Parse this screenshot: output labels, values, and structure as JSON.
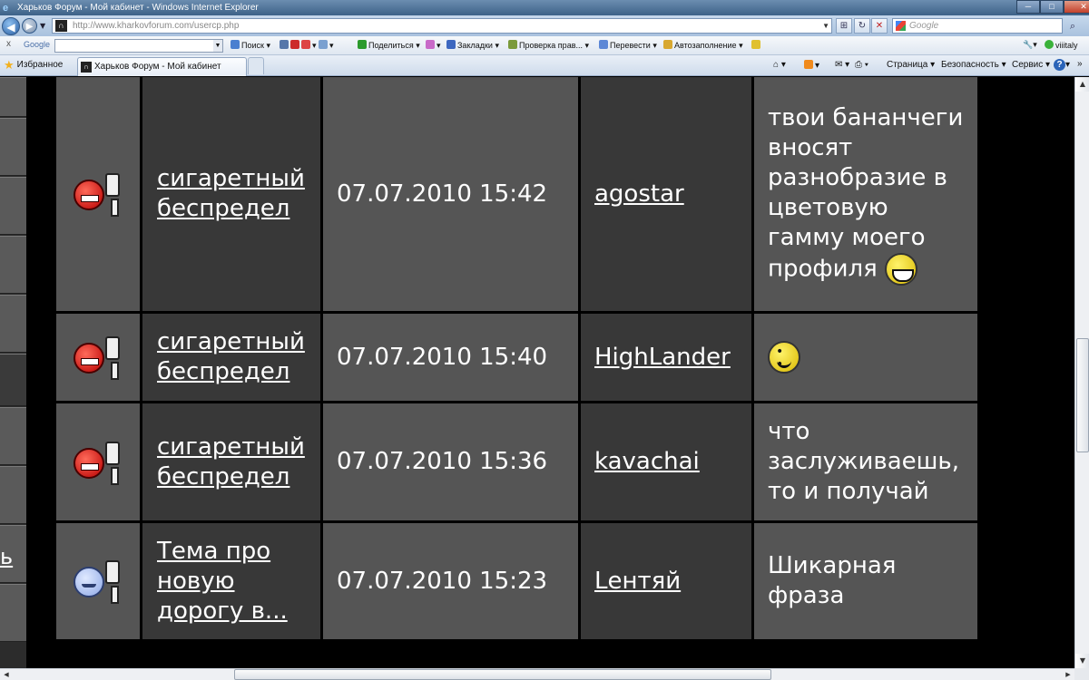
{
  "window": {
    "title": "Харьков Форум - Мой кабинет - Windows Internet Explorer",
    "controls": {
      "minimize": "─",
      "maximize": "□",
      "close": "✕"
    }
  },
  "address": {
    "url": "http://www.kharkovforum.com/usercp.php",
    "search_placeholder": "Google"
  },
  "google_toolbar": {
    "close": "x",
    "logo": "Google",
    "search_label": "Поиск",
    "share": "Поделиться",
    "bookmarks": "Закладки",
    "spellcheck": "Проверка прав...",
    "translate": "Перевести",
    "autofill": "Автозаполнение",
    "user": "viiitaly"
  },
  "favorites_bar": {
    "favorites": "Избранное",
    "tab_title": "Харьков Форум - Мой кабинет",
    "page_menu": "Страница",
    "safety_menu": "Безопасность",
    "service_menu": "Сервис",
    "help": "?"
  },
  "left_sidebar": {
    "letter": "ь"
  },
  "posts": [
    {
      "icon": "angry-sign-smiley-icon",
      "topic": "сигаретный беспредел",
      "date": "07.07.2010 15:42",
      "user": "agostar",
      "message": "твои бананчеги вносят разнобразие в цветовую гамму моего профиля",
      "message_icon": "grin-smiley-icon"
    },
    {
      "icon": "angry-sign-smiley-icon",
      "topic": "сигаретный беспредел",
      "date": "07.07.2010 15:40",
      "user": "HighLander",
      "message": "",
      "message_icon": "smile-smiley-icon"
    },
    {
      "icon": "angry-sign-smiley-icon",
      "topic": "сигаретный беспредел",
      "date": "07.07.2010 15:36",
      "user": "kavachai",
      "message": "что заслуживаешь, то и получай",
      "message_icon": ""
    },
    {
      "icon": "calm-sign-smiley-icon",
      "topic": "Тема про новую дорогу в...",
      "date": "07.07.2010 15:23",
      "user": "Lентяй",
      "message": "Шикарная фраза",
      "message_icon": ""
    }
  ],
  "colors": {
    "background": "#000000",
    "cell_light": "#555555",
    "cell_dark": "#383838",
    "text": "#ffffff"
  }
}
